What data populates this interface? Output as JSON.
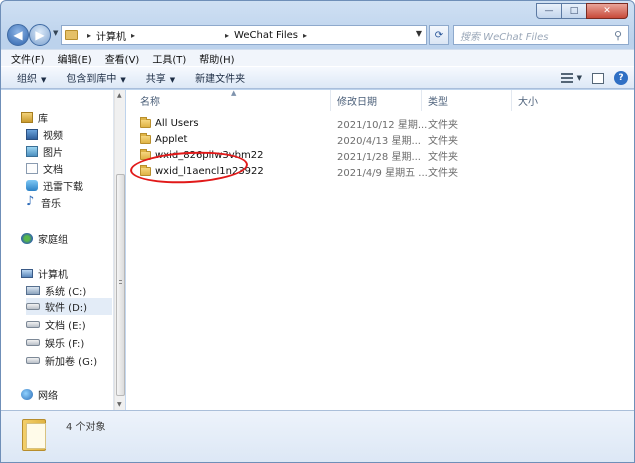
{
  "window": {
    "controls": {
      "minimize": "—",
      "maximize": "□",
      "close": "✕"
    }
  },
  "address_bar": {
    "crumbs": [
      "计算机",
      "WeChat Files"
    ],
    "separator": "▸"
  },
  "search": {
    "placeholder": "搜索 WeChat Files"
  },
  "menu": {
    "items": [
      "文件(F)",
      "编辑(E)",
      "查看(V)",
      "工具(T)",
      "帮助(H)"
    ]
  },
  "toolbar": {
    "organize": "组织",
    "include_in_library": "包含到库中",
    "share": "共享",
    "new_folder": "新建文件夹"
  },
  "sidebar": {
    "libraries": "库",
    "library_items": [
      "视频",
      "图片",
      "文档",
      "迅雷下载",
      "音乐"
    ],
    "homegroup": "家庭组",
    "computer": "计算机",
    "drives": [
      "系统 (C:)",
      "软件 (D:)",
      "文档 (E:)",
      "娱乐 (F:)",
      "新加卷 (G:)"
    ],
    "network": "网络"
  },
  "columns": {
    "name": "名称",
    "date": "修改日期",
    "type": "类型",
    "size": "大小"
  },
  "files": [
    {
      "name": "All Users",
      "date": "2021/10/12 星期...",
      "type": "文件夹"
    },
    {
      "name": "Applet",
      "date": "2020/4/13 星期...",
      "type": "文件夹"
    },
    {
      "name": "wxid_826pilw3vbm22",
      "date": "2021/1/28 星期...",
      "type": "文件夹"
    },
    {
      "name": "wxid_l1aencl1n23922",
      "date": "2021/4/9 星期五 ...",
      "type": "文件夹"
    }
  ],
  "status": {
    "object_count": "4 个对象"
  },
  "colors": {
    "highlight_ellipse": "#e11919",
    "accent": "#2f64ad"
  }
}
